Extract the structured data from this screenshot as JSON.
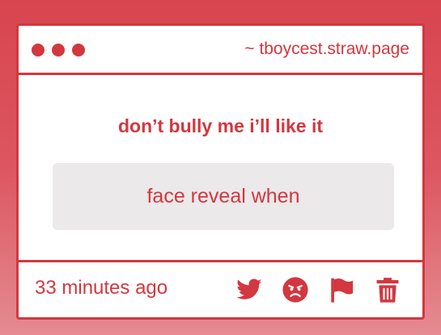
{
  "titlebar": {
    "url": "~ tboycest.straw.page"
  },
  "post": {
    "question": "don’t bully me i’ll like it",
    "answer": "face reveal when"
  },
  "footer": {
    "timestamp": "33 minutes ago",
    "actions": [
      "twitter-icon",
      "angry-face-icon",
      "flag-icon",
      "trash-icon"
    ]
  },
  "colors": {
    "accent": "#d3373f",
    "answer_bg": "#ebe9ea",
    "card_bg": "#ffffff"
  }
}
